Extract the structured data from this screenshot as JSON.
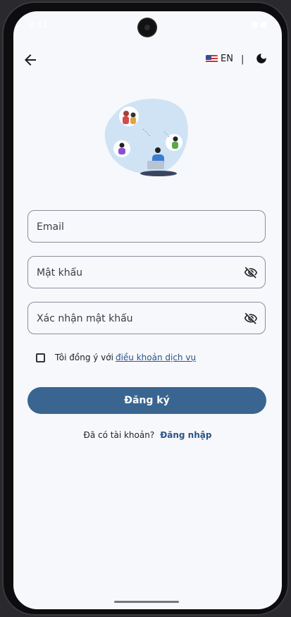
{
  "status": {
    "time": "9:41"
  },
  "header": {
    "language": "EN",
    "separator": "|"
  },
  "form": {
    "email_placeholder": "Email",
    "password_placeholder": "Mật khẩu",
    "confirm_password_placeholder": "Xác nhận mật khẩu"
  },
  "terms": {
    "prefix": "Tôi đồng ý với",
    "link": "điều khoản dịch vụ"
  },
  "actions": {
    "register_label": "Đăng ký"
  },
  "footer": {
    "have_account": "Đã có tài khoản?",
    "login_link": "Đăng nhập"
  },
  "colors": {
    "primary": "#396590",
    "link": "#2d5485",
    "background": "#f7f8fc"
  },
  "icons": [
    "back-arrow-icon",
    "us-flag-icon",
    "moon-icon",
    "eye-off-icon"
  ]
}
